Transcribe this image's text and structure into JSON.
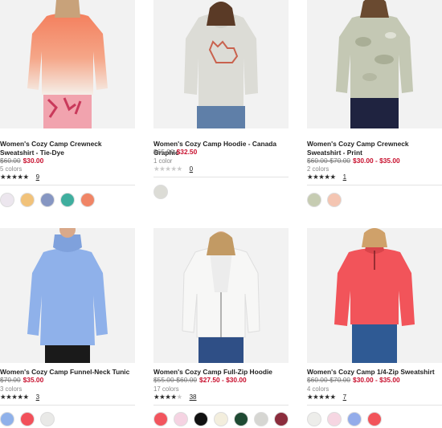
{
  "products": [
    {
      "title": "Women's Cozy Camp Crewneck Sweatshirt - Tie-Dye",
      "original_price": "$60.00",
      "sale_price": "$30.00",
      "colors_label": "5 colors",
      "rating_stars": "★★★★★",
      "rating_stars_empty": "",
      "review_count": "9",
      "swatches": [
        "#ece6ee",
        "#f1c27a",
        "#8696c2",
        "#3fae9e",
        "#f08566"
      ]
    },
    {
      "title": "Women's Cozy Camp Hoodie - Canada Graphic",
      "original_price": "$65.00",
      "sale_price": "$32.50",
      "colors_label": "1 color",
      "rating_stars": "",
      "rating_stars_empty": "★★★★★",
      "review_count": "0",
      "swatches": [
        "#dcdcd6"
      ]
    },
    {
      "title": "Women's Cozy Camp Crewneck Sweatshirt - Print",
      "original_price": "$60.00-$70.00",
      "sale_price": "$30.00 - $35.00",
      "colors_label": "2 colors",
      "rating_stars": "★★★★★",
      "rating_stars_empty": "",
      "review_count": "1",
      "swatches": [
        "#c6ccb2",
        "#f4c5b2"
      ]
    },
    {
      "title": "Women's Cozy Camp Funnel-Neck Tunic",
      "original_price": "$70.00",
      "sale_price": "$35.00",
      "colors_label": "3 colors",
      "rating_stars": "★★★★★",
      "rating_stars_empty": "",
      "review_count": "3",
      "swatches": [
        "#8fb1ea",
        "#f2505a",
        "#e9e9e7"
      ]
    },
    {
      "title": "Women's Cozy Camp Full-Zip Hoodie",
      "original_price": "$55.00-$60.00",
      "sale_price": "$27.50 - $30.00",
      "colors_label": "17 colors",
      "rating_stars": "★★★★",
      "rating_stars_empty": "★",
      "review_count": "38",
      "swatches": [
        "#f2555e",
        "#f5d3e2",
        "#111111",
        "#f3eedd",
        "#1f4a33",
        "#d6d6d2",
        "#8b2c3c"
      ]
    },
    {
      "title": "Women's Cozy Camp 1/4-Zip Sweatshirt",
      "original_price": "$60.00-$70.00",
      "sale_price": "$30.00 - $35.00",
      "colors_label": "4 colors",
      "rating_stars": "★★★★★",
      "rating_stars_empty": "",
      "review_count": "7",
      "swatches": [
        "#ededea",
        "#f6d6e2",
        "#93acea",
        "#f2545a"
      ]
    }
  ]
}
